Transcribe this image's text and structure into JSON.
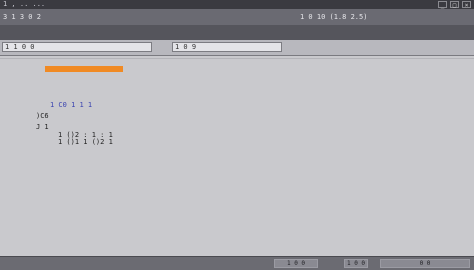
{
  "window": {
    "title": "1  ,  .. ...",
    "controls": [
      "_",
      "□",
      "×"
    ]
  },
  "menu": {
    "left_label": "3 1 3 0 2",
    "right_label": "1 0 10 (1.8 2.5)"
  },
  "tabs": {
    "field_a": "1 1 0 0",
    "field_b": "1 0 9"
  },
  "code": {
    "highlight_text": "",
    "lines": [
      ")C6",
      "J 1",
      "1 ()2 : 1 : 1",
      "1 C0 1 1 1",
      "1 ()1 1 ()2 1"
    ]
  },
  "status": {
    "buttons": [
      "1 0 0",
      "1 0 0",
      "0 0"
    ]
  },
  "colors": {
    "highlight": "#f08a24",
    "link": "#3a43b0"
  }
}
